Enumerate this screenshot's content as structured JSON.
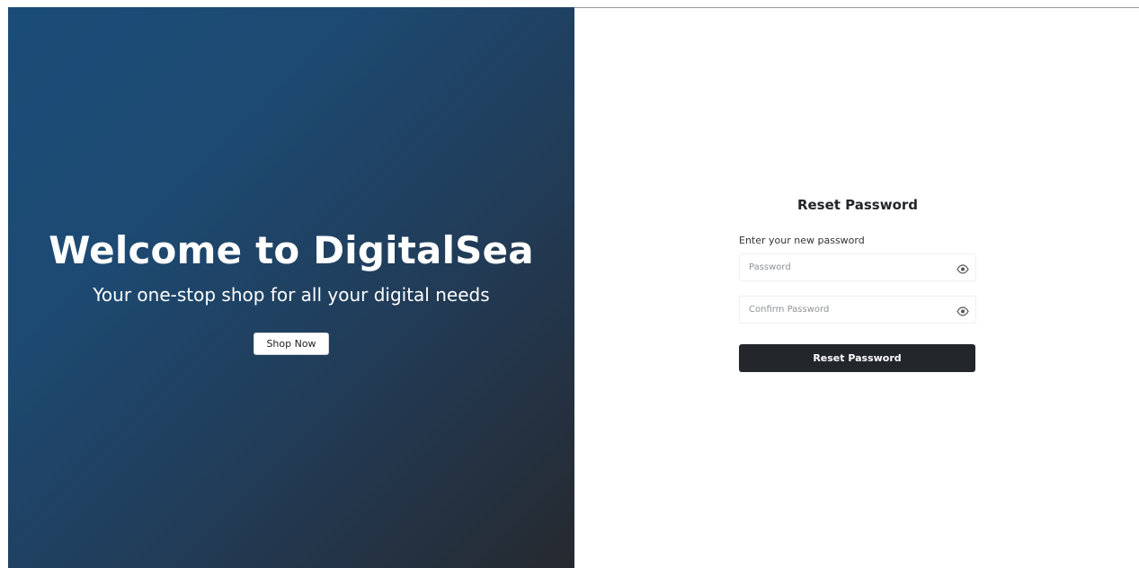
{
  "hero": {
    "title": "Welcome to DigitalSea",
    "subtitle": "Your one-stop shop for all your digital needs",
    "cta_label": "Shop Now"
  },
  "reset_form": {
    "title": "Reset Password",
    "instruction": "Enter your new password",
    "password": {
      "value": "",
      "placeholder": "Password",
      "icon": "eye-icon"
    },
    "confirm_password": {
      "value": "",
      "placeholder": "Confirm Password",
      "icon": "eye-icon"
    },
    "submit_label": "Reset Password"
  },
  "colors": {
    "hero_gradient_start": "#1a4c78",
    "hero_gradient_end": "#26292f",
    "submit_bg": "#23272c"
  }
}
